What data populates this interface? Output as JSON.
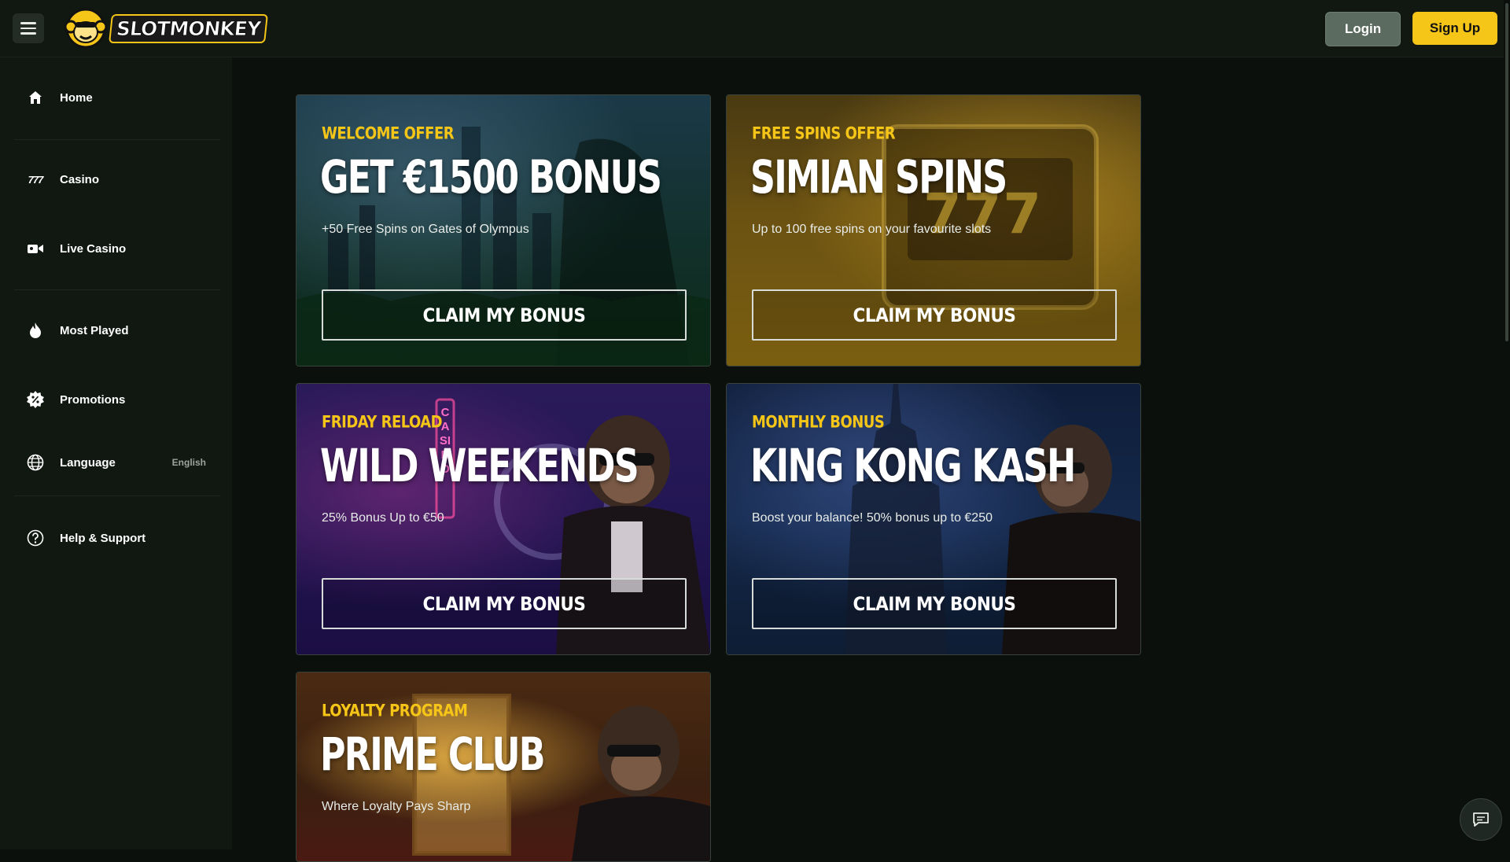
{
  "header": {
    "logo_text": "SLOTMONKEY",
    "login_label": "Login",
    "signup_label": "Sign Up"
  },
  "sidebar": {
    "items": [
      {
        "label": "Home",
        "icon": "home-icon"
      },
      {
        "label": "Casino",
        "icon": "slots-777-icon"
      },
      {
        "label": "Live Casino",
        "icon": "video-camera-icon"
      },
      {
        "label": "Most Played",
        "icon": "flame-icon"
      },
      {
        "label": "Promotions",
        "icon": "badge-percent-icon"
      },
      {
        "label": "Language",
        "icon": "globe-icon",
        "value": "English"
      },
      {
        "label": "Help & Support",
        "icon": "help-circle-icon"
      }
    ]
  },
  "promotions": [
    {
      "kicker": "WELCOME OFFER",
      "title": "GET €1500 BONUS",
      "subtitle": "+50 Free Spins on Gates of Olympus",
      "cta": "CLAIM MY BONUS"
    },
    {
      "kicker": "FREE SPINS OFFER",
      "title": "SIMIAN SPINS",
      "subtitle": "Up to 100 free spins on your favourite slots",
      "cta": "CLAIM MY BONUS"
    },
    {
      "kicker": "FRIDAY RELOAD",
      "title": "WILD WEEKENDS",
      "subtitle": "25% Bonus Up to €50",
      "cta": "CLAIM MY BONUS"
    },
    {
      "kicker": "MONTHLY BONUS",
      "title": "KING KONG KASH",
      "subtitle": "Boost your balance! 50% bonus up to €250",
      "cta": "CLAIM MY BONUS"
    },
    {
      "kicker": "LOYALTY PROGRAM",
      "title": "PRIME CLUB",
      "subtitle": "Where Loyalty Pays Sharp"
    }
  ],
  "decor": {
    "sevens": "777",
    "neon_sign": "CASINO"
  },
  "colors": {
    "accent": "#f5c518",
    "background": "#0b100c",
    "sidebar": "#111812",
    "login_button": "#5b6b5f"
  }
}
